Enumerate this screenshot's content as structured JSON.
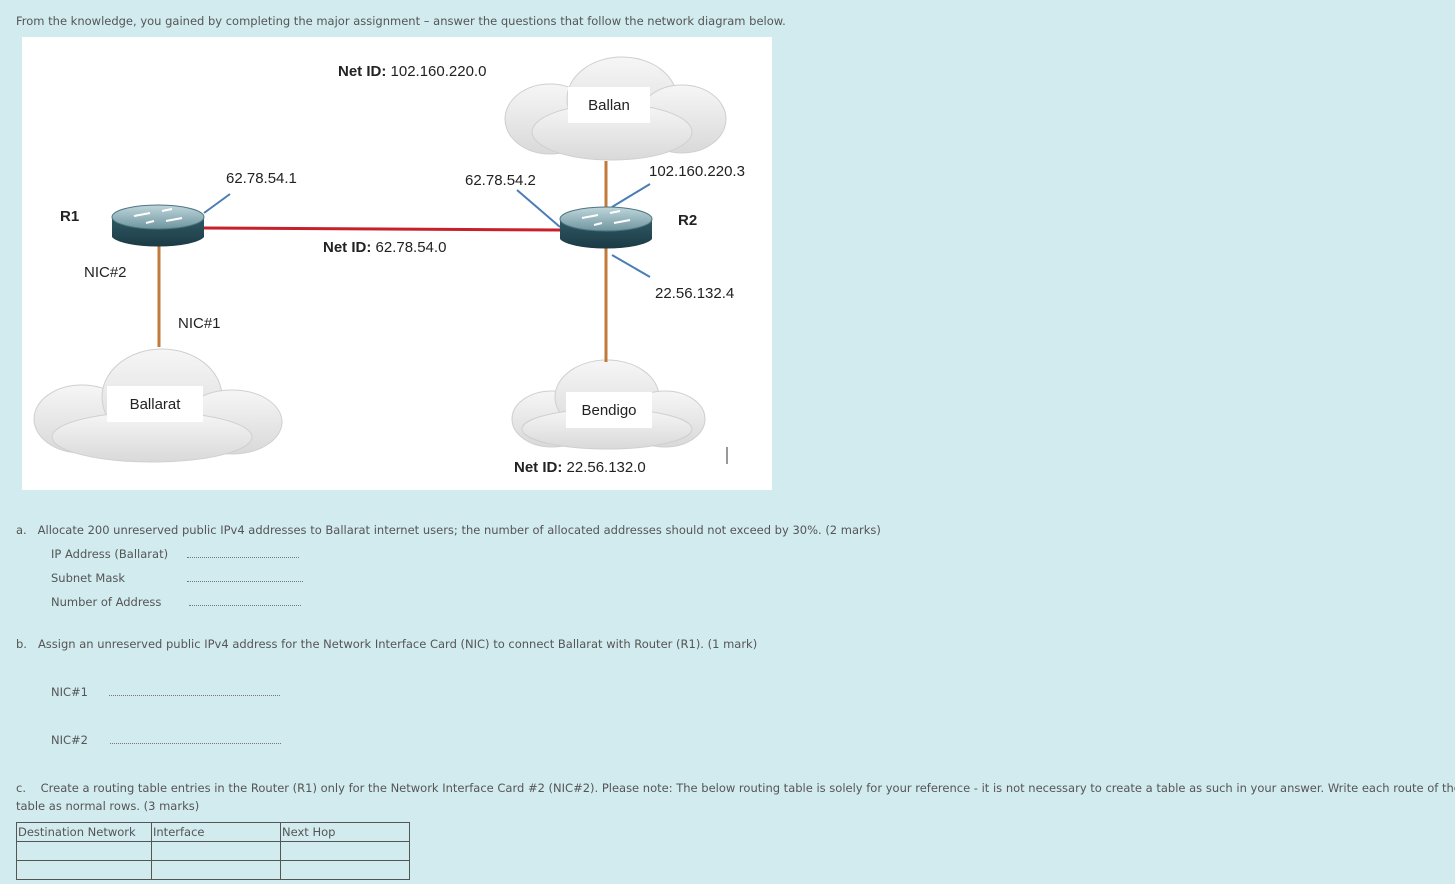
{
  "intro": "From the knowledge, you gained by completing the major assignment – answer the questions that follow the network diagram below.",
  "diagram": {
    "routers": {
      "r1": "R1",
      "r2": "R2"
    },
    "networks": {
      "ballan": "Ballan",
      "ballarat": "Ballarat",
      "bendigo": "Bendigo"
    },
    "net_id_prefix": "Net ID:",
    "net_ids": {
      "top": "102.160.220.0",
      "mid": "62.78.54.0",
      "bottom": "22.56.132.0"
    },
    "ips": {
      "r1_wan": "62.78.54.1",
      "r2_wan": "62.78.54.2",
      "r2_ballan": "102.160.220.3",
      "r2_bendigo": "22.56.132.4"
    },
    "nics": {
      "nic2": "NIC#2",
      "nic1": "NIC#1"
    },
    "colors": {
      "wan_link": "#c8202a",
      "lan_link": "#c07a3a",
      "callout": "#4a7db5"
    }
  },
  "q_a": {
    "marker": "a.",
    "text": "Allocate 200 unreserved public IPv4 addresses to Ballarat internet users; the number of allocated addresses should not exceed by 30%. (2 marks)",
    "fields": [
      "IP Address (Ballarat)",
      "Subnet Mask",
      "Number of Address"
    ]
  },
  "q_b": {
    "marker": "b.",
    "text": "Assign an unreserved public IPv4 address for the Network Interface Card (NIC) to connect Ballarat with Router (R1). (1 mark)",
    "fields": [
      "NIC#1",
      "NIC#2"
    ]
  },
  "q_c": {
    "marker": "c.",
    "line1": "Create a routing table entries in the Router (R1) only for the Network Interface Card #2 (NIC#2). Please note: The below routing table is solely for your reference - it is not necessary to create a table as such in your answer. Write each route of the routing",
    "line2": "table as normal rows.   (3 marks)"
  },
  "table": {
    "headers": [
      "Destination Network",
      "Interface",
      "Next Hop"
    ]
  }
}
